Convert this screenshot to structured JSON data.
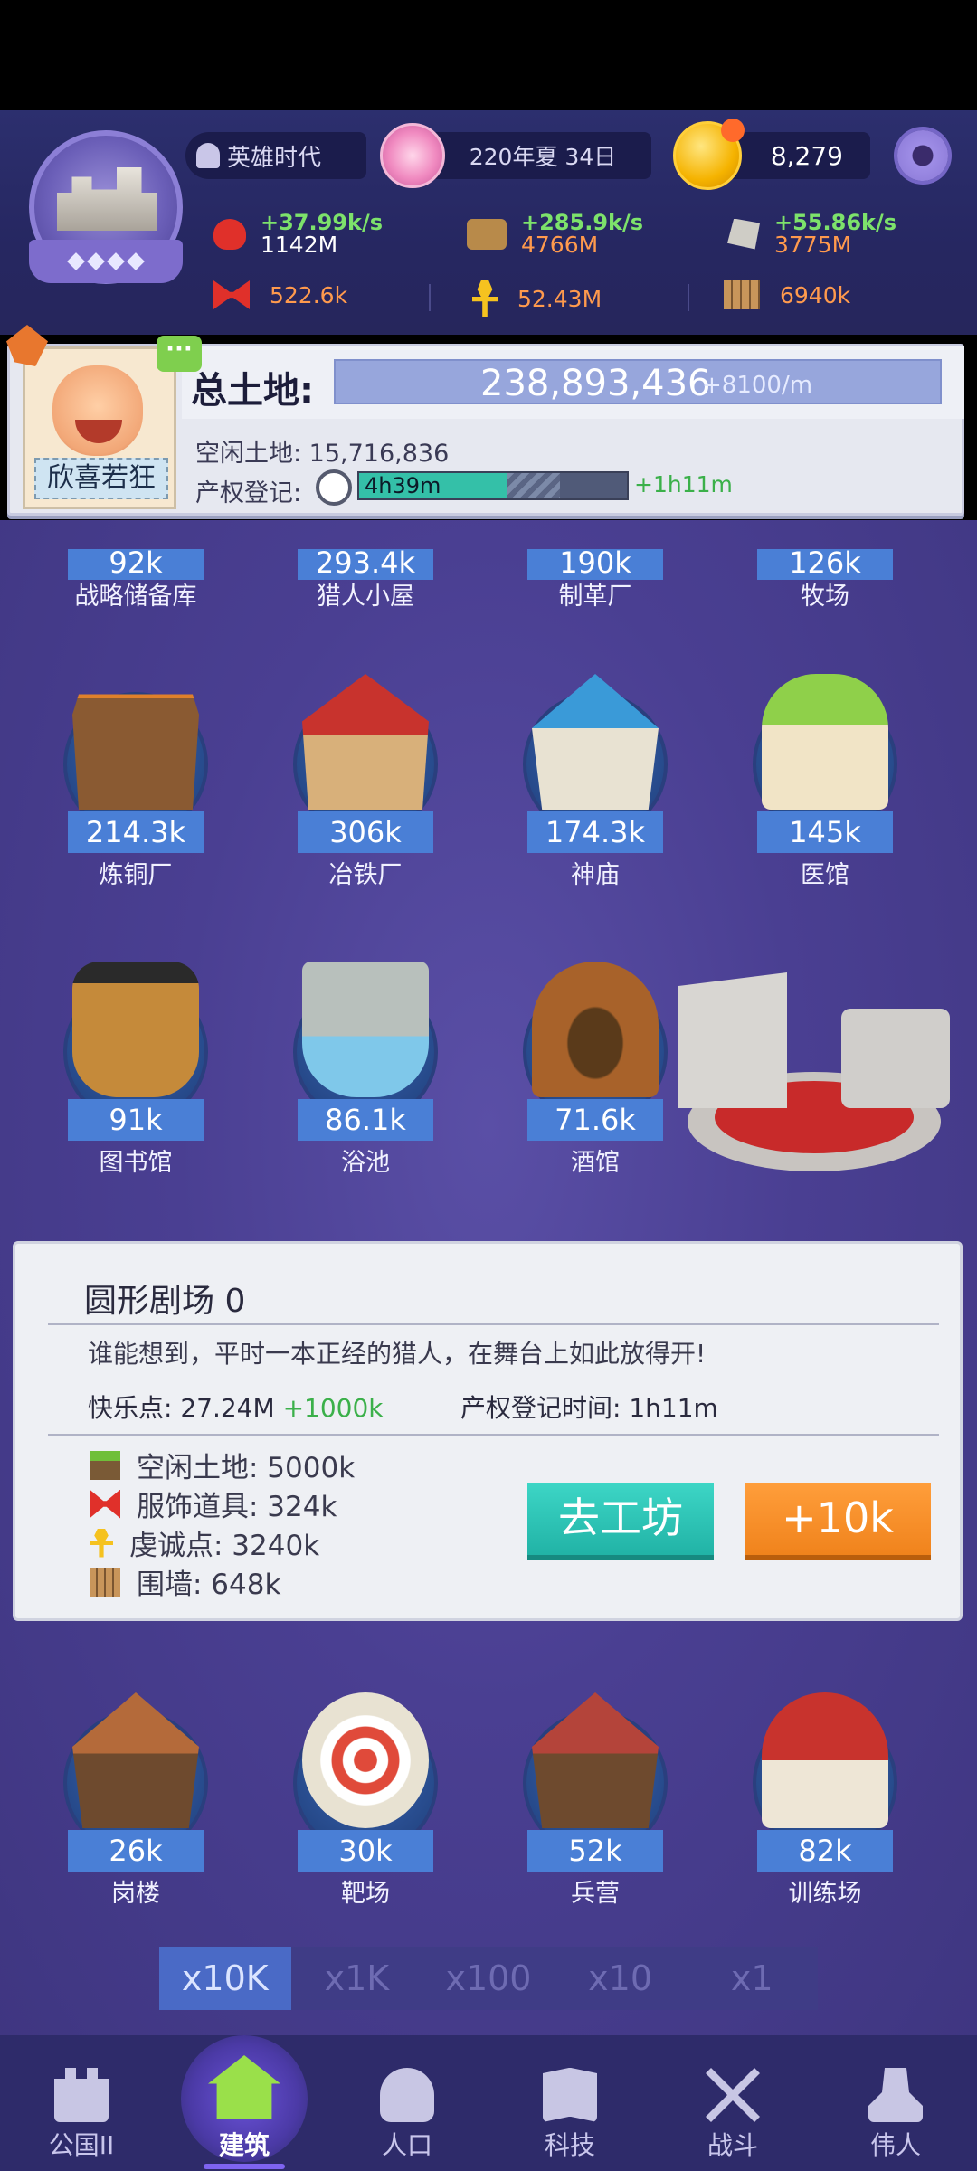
{
  "header": {
    "era": "英雄时代",
    "date": "220年夏 34日",
    "coins": "8,279",
    "resources_rate": [
      {
        "icon": "apple-icon",
        "rate": "+37.99k/s",
        "amount": "1142M",
        "amount_color": "white"
      },
      {
        "icon": "wood-icon",
        "rate": "+285.9k/s",
        "amount": "4766M",
        "amount_color": "orange"
      },
      {
        "icon": "stone-icon",
        "rate": "+55.86k/s",
        "amount": "3775M",
        "amount_color": "orange"
      }
    ],
    "resources_static": [
      {
        "icon": "bowtie-icon",
        "amount": "522.6k"
      },
      {
        "icon": "ankh-icon",
        "amount": "52.43M"
      },
      {
        "icon": "fence-icon",
        "amount": "6940k"
      }
    ]
  },
  "land": {
    "ruler_name": "欣喜若狂",
    "total_label": "总土地:",
    "total_value": "238,893,436",
    "total_rate": "+8100/m",
    "idle_label": "空闲土地: 15,716,836",
    "registration_label": "产权登记:",
    "registration_time": "4h39m",
    "registration_extra": "+1h11m",
    "registration_progress": 0.55
  },
  "buildings_top_partial": [
    {
      "value": "92k",
      "label": "战略储备库"
    },
    {
      "value": "293.4k",
      "label": "猎人小屋"
    },
    {
      "value": "190k",
      "label": "制革厂"
    },
    {
      "value": "126k",
      "label": "牧场"
    }
  ],
  "buildings_row1": [
    {
      "value": "214.3k",
      "label": "炼铜厂",
      "color": "#8a5a32"
    },
    {
      "value": "306k",
      "label": "冶铁厂",
      "color": "#c8332d"
    },
    {
      "value": "174.3k",
      "label": "神庙",
      "color": "#3a9ad8"
    },
    {
      "value": "145k",
      "label": "医馆",
      "color": "#8fd04a"
    }
  ],
  "buildings_row2": [
    {
      "value": "91k",
      "label": "图书馆",
      "color": "#c58a3a"
    },
    {
      "value": "86.1k",
      "label": "浴池",
      "color": "#7fc8ea"
    },
    {
      "value": "71.6k",
      "label": "酒馆",
      "color": "#a8622a"
    }
  ],
  "info_panel": {
    "title": "圆形剧场 0",
    "description": "谁能想到，平时一本正经的猎人，在舞台上如此放得开!",
    "happiness_label": "快乐点: 27.24M",
    "happiness_plus": "+1000k",
    "registration_time_label": "产权登记时间:   1h11m",
    "costs": [
      {
        "icon": "land-icon",
        "text": "空闲土地:  5000k"
      },
      {
        "icon": "bowtie-icon",
        "text": "服饰道具:  324k"
      },
      {
        "icon": "ankh-icon",
        "text": "虔诚点:  3240k"
      },
      {
        "icon": "fence-icon",
        "text": "围墙:  648k"
      }
    ],
    "workshop_button": "去工坊",
    "plus_button": "+10k"
  },
  "buildings_row3": [
    {
      "value": "26k",
      "label": "岗楼",
      "color": "#b46a3a"
    },
    {
      "value": "30k",
      "label": "靶场",
      "color": "#e04a3a"
    },
    {
      "value": "52k",
      "label": "兵营",
      "color": "#b4443a"
    },
    {
      "value": "82k",
      "label": "训练场",
      "color": "#c8332d"
    }
  ],
  "multipliers": [
    "x10K",
    "x1K",
    "x100",
    "x10",
    "x1"
  ],
  "multiplier_active": "x10K",
  "nav": [
    {
      "label": "公国II",
      "icon": "castle-icon"
    },
    {
      "label": "建筑",
      "icon": "house-icon",
      "active": true
    },
    {
      "label": "人口",
      "icon": "person-icon"
    },
    {
      "label": "科技",
      "icon": "book-icon"
    },
    {
      "label": "战斗",
      "icon": "swords-icon"
    },
    {
      "label": "伟人",
      "icon": "bust-icon"
    }
  ]
}
